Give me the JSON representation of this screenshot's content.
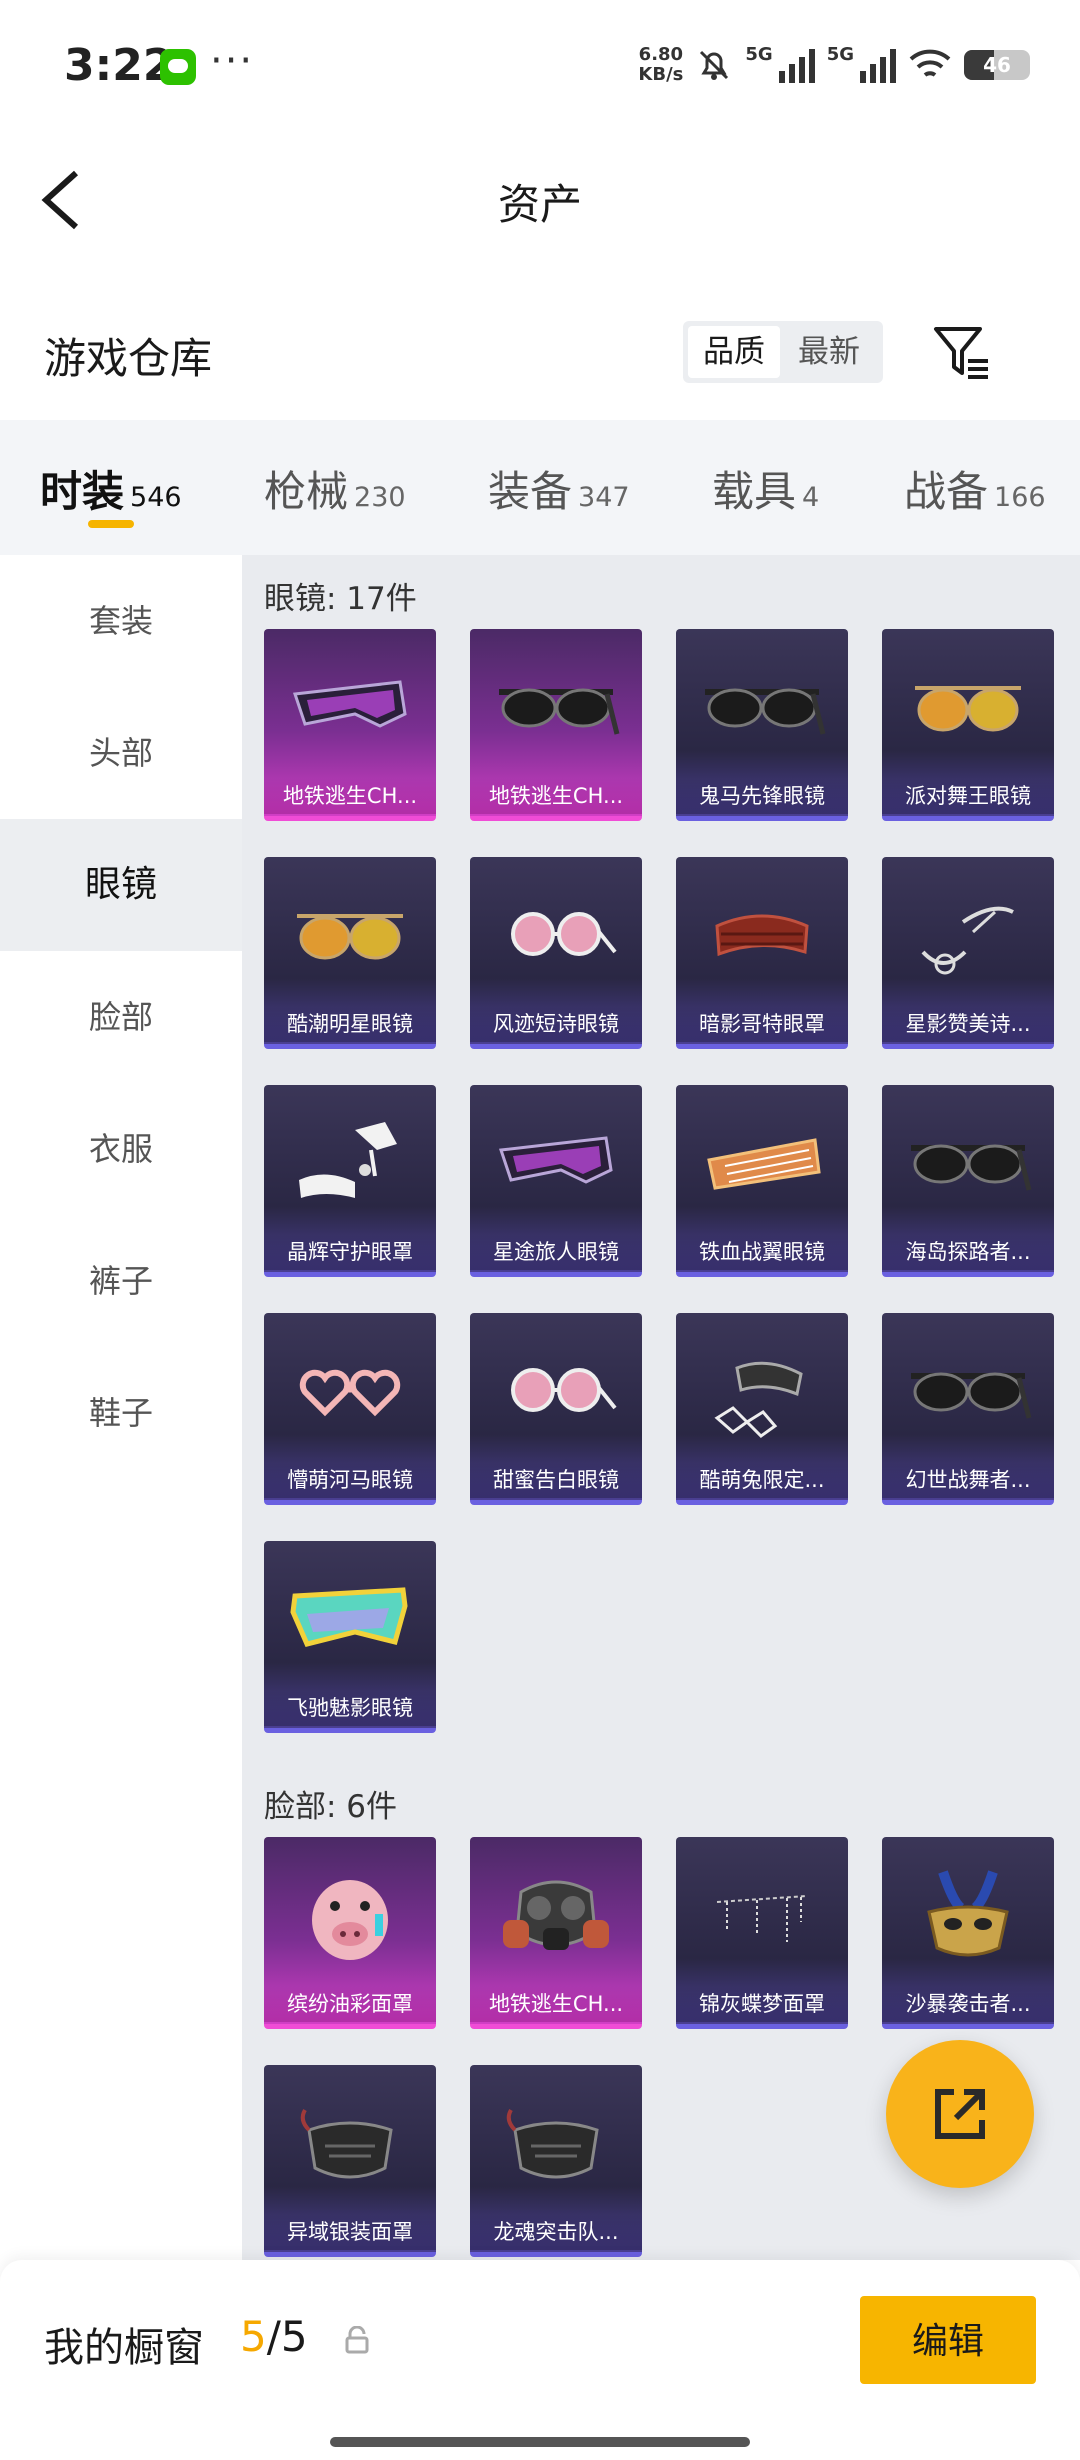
{
  "status_bar": {
    "time": "3:22",
    "more": "···",
    "speed_value": "6.80",
    "speed_unit": "KB/s",
    "net1": "5G",
    "net2": "5G",
    "battery": "46"
  },
  "header": {
    "title": "资产"
  },
  "warehouse": {
    "title": "游戏仓库",
    "sort_options": [
      "品质",
      "最新"
    ],
    "active_sort": "品质"
  },
  "category_tabs": [
    {
      "label": "时装",
      "count": "546",
      "active": true
    },
    {
      "label": "枪械",
      "count": "230"
    },
    {
      "label": "装备",
      "count": "347"
    },
    {
      "label": "载具",
      "count": "4"
    },
    {
      "label": "战备",
      "count": "166"
    }
  ],
  "sidebar": {
    "items": [
      "套装",
      "头部",
      "眼镜",
      "脸部",
      "衣服",
      "裤子",
      "鞋子"
    ],
    "active": "眼镜"
  },
  "groups": [
    {
      "title": "眼镜: 17件",
      "items": [
        {
          "name": "地铁逃生CH...",
          "rarity": "pink",
          "icon": "visor-glasses-icon"
        },
        {
          "name": "地铁逃生CH...",
          "rarity": "pink",
          "icon": "sunglasses-icon"
        },
        {
          "name": "鬼马先锋眼镜",
          "rarity": "purple",
          "icon": "sunglasses-icon"
        },
        {
          "name": "派对舞王眼镜",
          "rarity": "purple",
          "icon": "aviator-glasses-icon"
        },
        {
          "name": "酷潮明星眼镜",
          "rarity": "purple",
          "icon": "aviator-glasses-icon"
        },
        {
          "name": "风迹短诗眼镜",
          "rarity": "purple",
          "icon": "round-glasses-icon"
        },
        {
          "name": "暗影哥特眼罩",
          "rarity": "purple",
          "icon": "blindfold-icon"
        },
        {
          "name": "星影赞美诗...",
          "rarity": "purple",
          "icon": "monocle-icon"
        },
        {
          "name": "晶辉守护眼罩",
          "rarity": "purple",
          "icon": "lace-eyepatch-icon"
        },
        {
          "name": "星途旅人眼镜",
          "rarity": "purple",
          "icon": "visor-glasses-icon"
        },
        {
          "name": "铁血战翼眼镜",
          "rarity": "purple",
          "icon": "shutter-glasses-icon"
        },
        {
          "name": "海岛探路者...",
          "rarity": "purple",
          "icon": "sunglasses-icon"
        },
        {
          "name": "懵萌河马眼镜",
          "rarity": "purple",
          "icon": "heart-glasses-icon"
        },
        {
          "name": "甜蜜告白眼镜",
          "rarity": "purple",
          "icon": "round-glasses-icon"
        },
        {
          "name": "酷萌兔限定...",
          "rarity": "purple",
          "icon": "goggles-icon"
        },
        {
          "name": "幻世战舞者...",
          "rarity": "purple",
          "icon": "sunglasses-icon"
        },
        {
          "name": "飞驰魅影眼镜",
          "rarity": "purple",
          "icon": "sport-visor-icon"
        }
      ]
    },
    {
      "title": "脸部: 6件",
      "items": [
        {
          "name": "缤纷油彩面罩",
          "rarity": "pink",
          "icon": "pig-mask-icon"
        },
        {
          "name": "地铁逃生CH...",
          "rarity": "pink",
          "icon": "gas-mask-icon"
        },
        {
          "name": "锦灰蝶梦面罩",
          "rarity": "purple",
          "icon": "veil-chain-icon"
        },
        {
          "name": "沙暴袭击者...",
          "rarity": "purple",
          "icon": "masquerade-mask-icon"
        },
        {
          "name": "异域银装面罩",
          "rarity": "purple",
          "icon": "face-guard-icon"
        },
        {
          "name": "龙魂突击队...",
          "rarity": "purple",
          "icon": "face-guard-icon"
        }
      ]
    }
  ],
  "showcase": {
    "label": "我的橱窗",
    "current": "5",
    "separator": "/",
    "total": "5"
  },
  "edit_button": "编辑"
}
